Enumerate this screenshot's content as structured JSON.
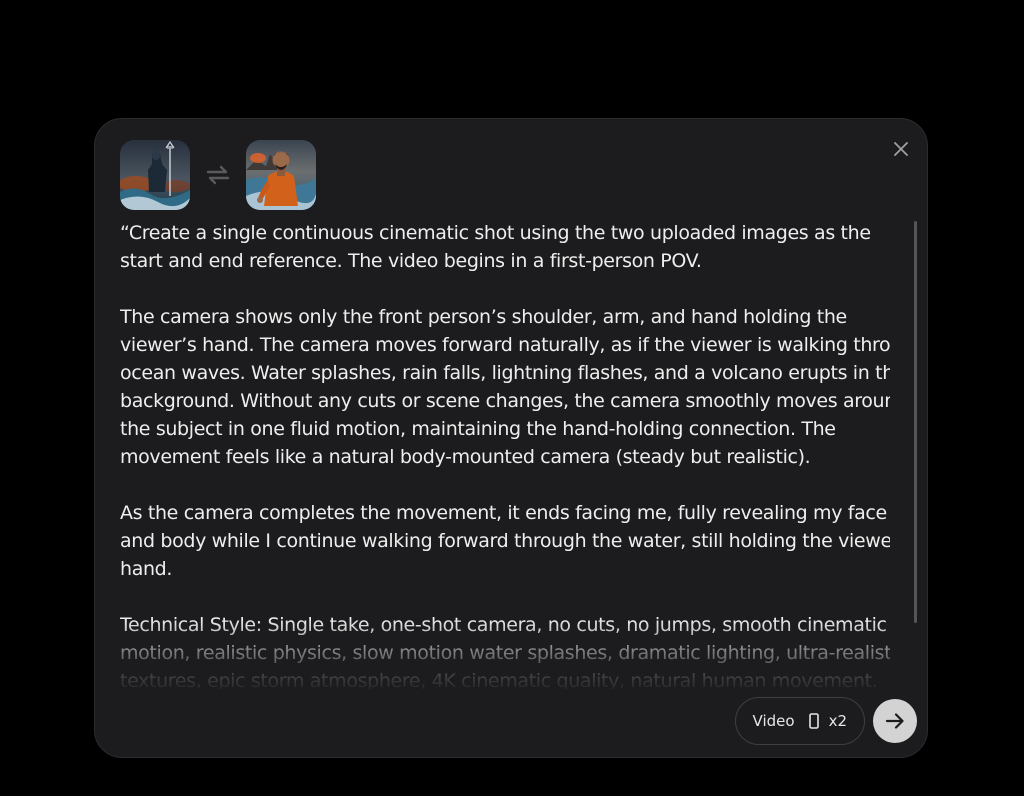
{
  "dialog": {
    "close_icon": "close-icon",
    "swap_icon": "swap-arrows-icon"
  },
  "reference_images": [
    {
      "role": "start",
      "depicts": "figure-standing-in-storm-waves"
    },
    {
      "role": "end",
      "depicts": "man-in-orange-kurta-in-ocean"
    }
  ],
  "prompt": {
    "paragraphs": [
      [
        "“Create a single continuous cinematic shot using the two uploaded images as the",
        "start and end reference. The video begins in a first-person POV."
      ],
      [
        "The camera shows only the front person’s shoulder, arm, and hand holding the",
        "viewer’s hand. The camera moves forward naturally, as if the viewer is walking through",
        "ocean waves. Water splashes, rain falls, lightning flashes, and a volcano erupts in the",
        "background. Without any cuts or scene changes, the camera smoothly moves around",
        "the subject in one fluid motion, maintaining the hand-holding connection. The",
        "movement feels like a natural body-mounted camera (steady but realistic)."
      ],
      [
        "As the camera completes the movement, it ends facing me, fully revealing my face",
        "and body while I continue walking forward through the water, still holding the viewer’s",
        "hand."
      ],
      [
        "Technical Style: Single take, one-shot camera, no cuts, no jumps, smooth cinematic",
        "motion, realistic physics, slow motion water splashes, dramatic lighting, ultra-realistic",
        "textures, epic storm atmosphere, 4K cinematic quality, natural human movement."
      ]
    ]
  },
  "controls": {
    "mode_label": "Video",
    "aspect_icon": "portrait-aspect-icon",
    "count_label": "x2",
    "send_icon": "arrow-right-icon"
  },
  "colors": {
    "panel_bg": "#1c1c1e",
    "text": "#eeeeee",
    "send_bg": "#d3d3d3"
  }
}
